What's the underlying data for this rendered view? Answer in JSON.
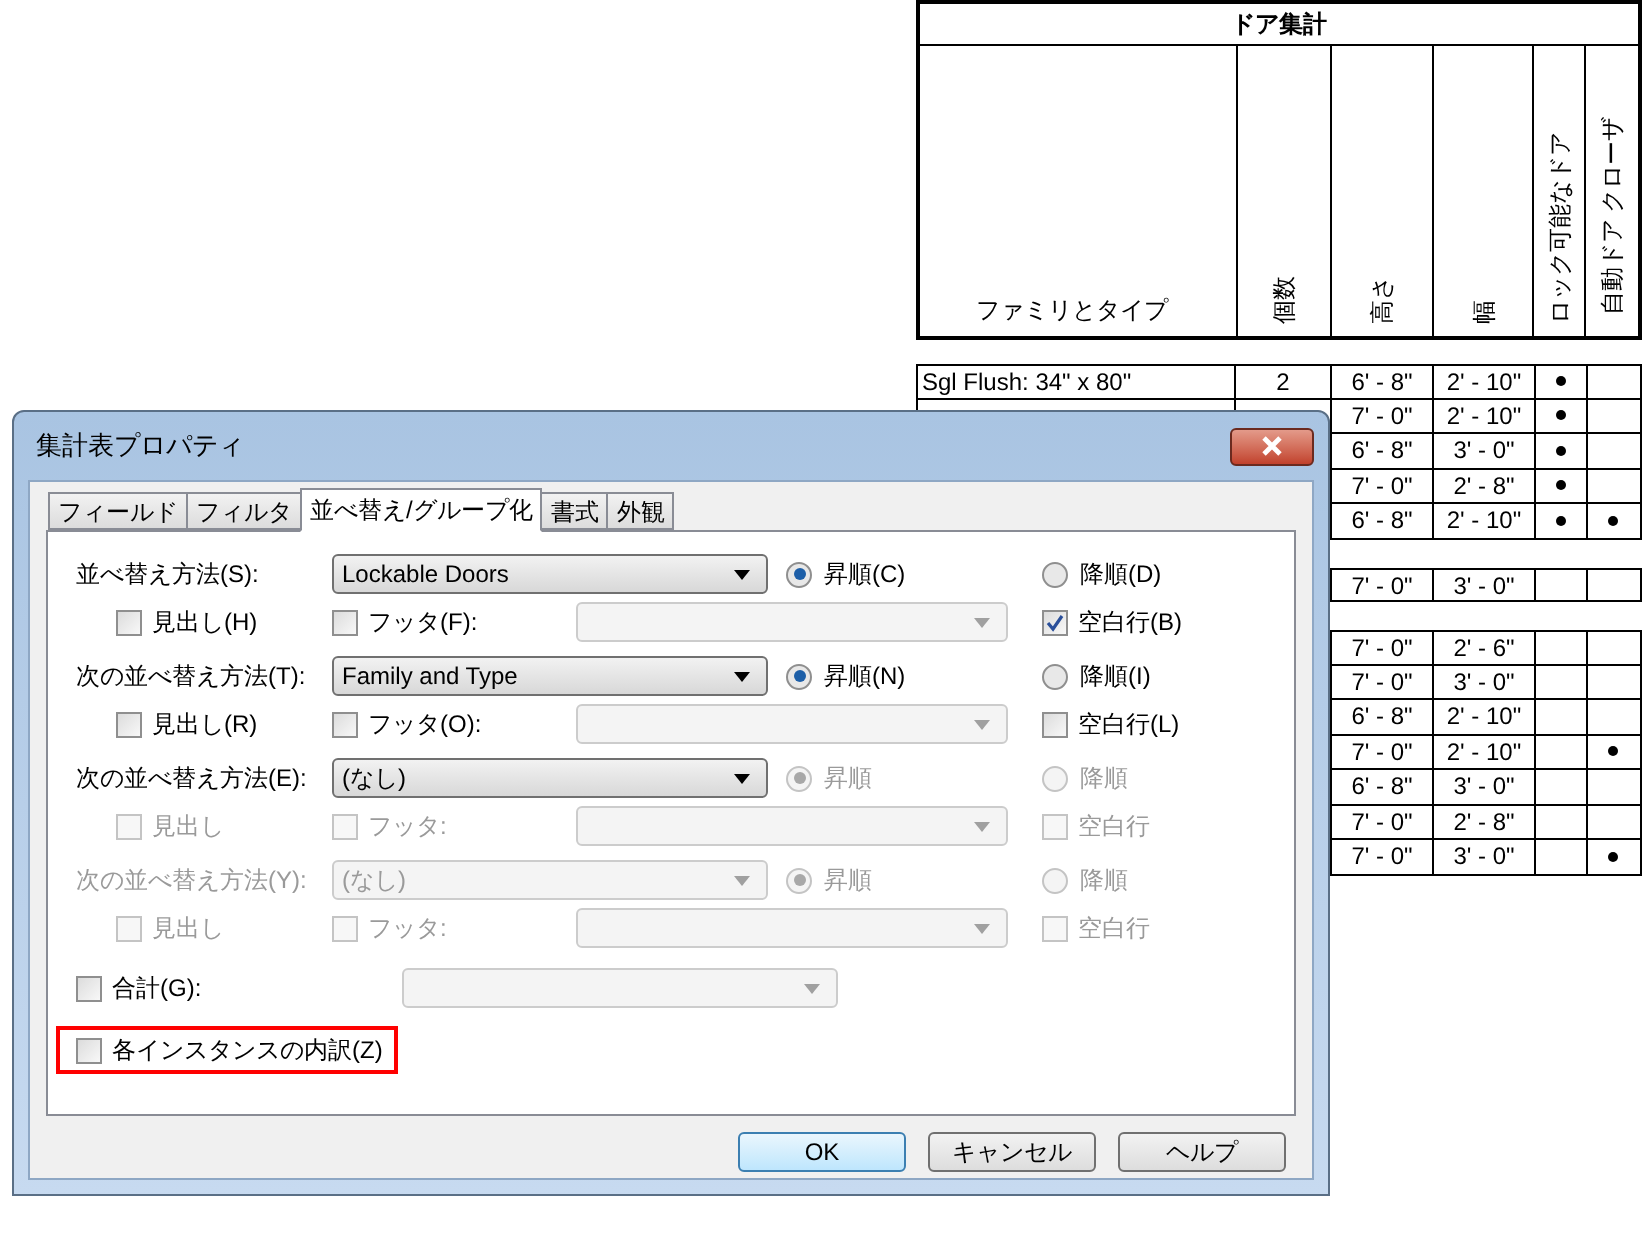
{
  "schedule": {
    "title": "ドア集計",
    "columns": [
      {
        "label": "ファミリとタイプ",
        "kind": "horizontal"
      },
      {
        "label": "個数",
        "kind": "vertical"
      },
      {
        "label": "高さ",
        "kind": "vertical"
      },
      {
        "label": "幅",
        "kind": "vertical"
      },
      {
        "label": "ロック可能なドア",
        "kind": "vertical"
      },
      {
        "label": "自動ドア クローザ",
        "kind": "vertical"
      }
    ],
    "rows": [
      {
        "kind": "data",
        "family": "Sgl Flush: 34\" x 80\"",
        "count": "2",
        "height": "6' - 8\"",
        "width": "2' - 10\"",
        "lockable": true,
        "auto_closer": false
      },
      {
        "kind": "data",
        "height": "7' - 0\"",
        "width": "2' - 10\"",
        "lockable": true,
        "auto_closer": false
      },
      {
        "kind": "data",
        "height": "6' - 8\"",
        "width": "3' - 0\"",
        "lockable": true,
        "auto_closer": false
      },
      {
        "kind": "data",
        "height": "7' - 0\"",
        "width": "2' - 8\"",
        "lockable": true,
        "auto_closer": false
      },
      {
        "kind": "data",
        "height": "6' - 8\"",
        "width": "2' - 10\"",
        "lockable": true,
        "auto_closer": true
      },
      {
        "kind": "blank"
      },
      {
        "kind": "data",
        "height": "7' - 0\"",
        "width": "3' - 0\"",
        "lockable": false,
        "auto_closer": false
      },
      {
        "kind": "blank"
      },
      {
        "kind": "data",
        "height": "7' - 0\"",
        "width": "2' - 6\"",
        "lockable": false,
        "auto_closer": false
      },
      {
        "kind": "data",
        "height": "7' - 0\"",
        "width": "3' - 0\"",
        "lockable": false,
        "auto_closer": false
      },
      {
        "kind": "data",
        "height": "6' - 8\"",
        "width": "2' - 10\"",
        "lockable": false,
        "auto_closer": false
      },
      {
        "kind": "data",
        "height": "7' - 0\"",
        "width": "2' - 10\"",
        "lockable": false,
        "auto_closer": true
      },
      {
        "kind": "data",
        "height": "6' - 8\"",
        "width": "3' - 0\"",
        "lockable": false,
        "auto_closer": false
      },
      {
        "kind": "data",
        "height": "7' - 0\"",
        "width": "2' - 8\"",
        "lockable": false,
        "auto_closer": false
      },
      {
        "kind": "data",
        "height": "7' - 0\"",
        "width": "3' - 0\"",
        "lockable": false,
        "auto_closer": true
      }
    ]
  },
  "dialog": {
    "title": "集計表プロパティ",
    "tabs": [
      {
        "label": "フィールド",
        "selected": false
      },
      {
        "label": "フィルタ",
        "selected": false
      },
      {
        "label": "並べ替え/グループ化",
        "selected": true
      },
      {
        "label": "書式",
        "selected": false
      },
      {
        "label": "外観",
        "selected": false
      }
    ],
    "sort_groups": [
      {
        "label": "並べ替え方法(S):",
        "disabled": false,
        "select": {
          "value": "Lockable Doors",
          "disabled": false
        },
        "ascending": {
          "label": "昇順(C)",
          "selected": true,
          "disabled": false
        },
        "descending": {
          "label": "降順(D)",
          "selected": false,
          "disabled": false
        },
        "header": {
          "label": "見出し(H)",
          "checked": false,
          "disabled": false
        },
        "footer": {
          "label": "フッタ(F):",
          "checked": false,
          "disabled": false
        },
        "footer_select": {
          "disabled": true
        },
        "blank_line": {
          "label": "空白行(B)",
          "checked": true,
          "disabled": false
        }
      },
      {
        "label": "次の並べ替え方法(T):",
        "disabled": false,
        "select": {
          "value": "Family and Type",
          "disabled": false
        },
        "ascending": {
          "label": "昇順(N)",
          "selected": true,
          "disabled": false
        },
        "descending": {
          "label": "降順(I)",
          "selected": false,
          "disabled": false
        },
        "header": {
          "label": "見出し(R)",
          "checked": false,
          "disabled": false
        },
        "footer": {
          "label": "フッタ(O):",
          "checked": false,
          "disabled": false
        },
        "footer_select": {
          "disabled": true
        },
        "blank_line": {
          "label": "空白行(L)",
          "checked": false,
          "disabled": false
        }
      },
      {
        "label": "次の並べ替え方法(E):",
        "disabled": false,
        "select": {
          "value": "(なし)",
          "disabled": false
        },
        "ascending": {
          "label": "昇順",
          "selected": true,
          "disabled": true
        },
        "descending": {
          "label": "降順",
          "selected": false,
          "disabled": true
        },
        "header": {
          "label": "見出し",
          "checked": false,
          "disabled": true
        },
        "footer": {
          "label": "フッタ:",
          "checked": false,
          "disabled": true
        },
        "footer_select": {
          "disabled": true
        },
        "blank_line": {
          "label": "空白行",
          "checked": false,
          "disabled": true
        }
      },
      {
        "label": "次の並べ替え方法(Y):",
        "disabled": true,
        "select": {
          "value": "(なし)",
          "disabled": true
        },
        "ascending": {
          "label": "昇順",
          "selected": true,
          "disabled": true
        },
        "descending": {
          "label": "降順",
          "selected": false,
          "disabled": true
        },
        "header": {
          "label": "見出し",
          "checked": false,
          "disabled": true
        },
        "footer": {
          "label": "フッタ:",
          "checked": false,
          "disabled": true
        },
        "footer_select": {
          "disabled": true
        },
        "blank_line": {
          "label": "空白行",
          "checked": false,
          "disabled": true
        }
      }
    ],
    "total": {
      "label": "合計(G):",
      "checked": false,
      "disabled": false,
      "select": {
        "disabled": true
      }
    },
    "itemize": {
      "label": "各インスタンスの内訳(Z)",
      "checked": false,
      "disabled": false,
      "highlighted": true
    },
    "buttons": [
      {
        "label": "OK",
        "default": true
      },
      {
        "label": "キャンセル",
        "default": false
      },
      {
        "label": "ヘルプ",
        "default": false
      }
    ]
  }
}
